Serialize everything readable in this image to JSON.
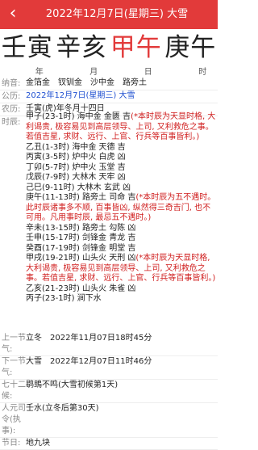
{
  "header": {
    "back_icon": "chevron-left-icon",
    "title": "2022年12月7日(星期三) 大雪",
    "accent_color": "#e23a3a"
  },
  "pillars": [
    {
      "char": "壬寅",
      "color": "black"
    },
    {
      "char": "辛亥",
      "color": "black"
    },
    {
      "char": "甲午",
      "color": "red"
    },
    {
      "char": "庚午",
      "color": "black"
    }
  ],
  "column_heads": [
    "年",
    "月",
    "日",
    "时"
  ],
  "info": {
    "nayin_label": "纳音:",
    "nayin_value": "金箔金　钗钏金　沙中金　路旁土",
    "gongli_label": "公历:",
    "gongli_value": "2022年12月7日(星期三) 大雪",
    "nongli_label": "农历:",
    "nongli_value": "壬寅(虎)年冬月十四日",
    "shichen_label": "时辰:"
  },
  "hours": [
    {
      "text": "甲子(23-1时) 海中金 金匮 吉",
      "note": "(*本时辰为天显时格, 大利谒贵, 极容易见到高层领导、上司, 又利救危之事。若值吉星, 求财、远行、上官、行兵等百事皆利。)"
    },
    {
      "text": "乙丑(1-3时) 海中金 天德 吉",
      "note": ""
    },
    {
      "text": "丙寅(3-5时) 炉中火 白虎 凶",
      "note": ""
    },
    {
      "text": "丁卯(5-7时) 炉中火 玉堂 吉",
      "note": ""
    },
    {
      "text": "戊辰(7-9时) 大林木 天牢 凶",
      "note": ""
    },
    {
      "text": "己巳(9-11时) 大林木 玄武 凶",
      "note": ""
    },
    {
      "text": "庚午(11-13时) 路旁土 司命 吉",
      "note": "(*本时辰为五不遇时。此时辰诸事多不顺, 百事皆凶, 纵然得三奇吉门, 也不可用。凡用事时辰, 最忌五不遇时。)"
    },
    {
      "text": "辛未(13-15时) 路旁土 勾陈 凶",
      "note": ""
    },
    {
      "text": "壬申(15-17时) 剑锋金 青龙 吉",
      "note": ""
    },
    {
      "text": "癸酉(17-19时) 剑锋金 明堂 吉",
      "note": ""
    },
    {
      "text": "甲戌(19-21时) 山头火 天刑 凶",
      "note": "(*本时辰为天显时格, 大利谒贵, 极容易见到高层领导、上司, 又利救危之事。若值吉星, 求财、远行、上官、行兵等百事皆利。)"
    },
    {
      "text": "乙亥(21-23时) 山头火 朱雀 凶",
      "note": ""
    },
    {
      "text": "丙子(23-1时) 涧下水",
      "note": ""
    }
  ],
  "bottom": [
    {
      "label": "上一节气:",
      "value": "立冬　2022年11月07日18时45分"
    },
    {
      "label": "下一节气:",
      "value": "大雪　2022年12月07日11时46分"
    },
    {
      "label": "七十二候:",
      "value": "鹖鴠不鸣(大雪初候第1天)"
    },
    {
      "label": "人元司令(执事):",
      "value": "壬水(立冬后第30天)"
    },
    {
      "label": "节日:",
      "value": "地九块"
    }
  ]
}
